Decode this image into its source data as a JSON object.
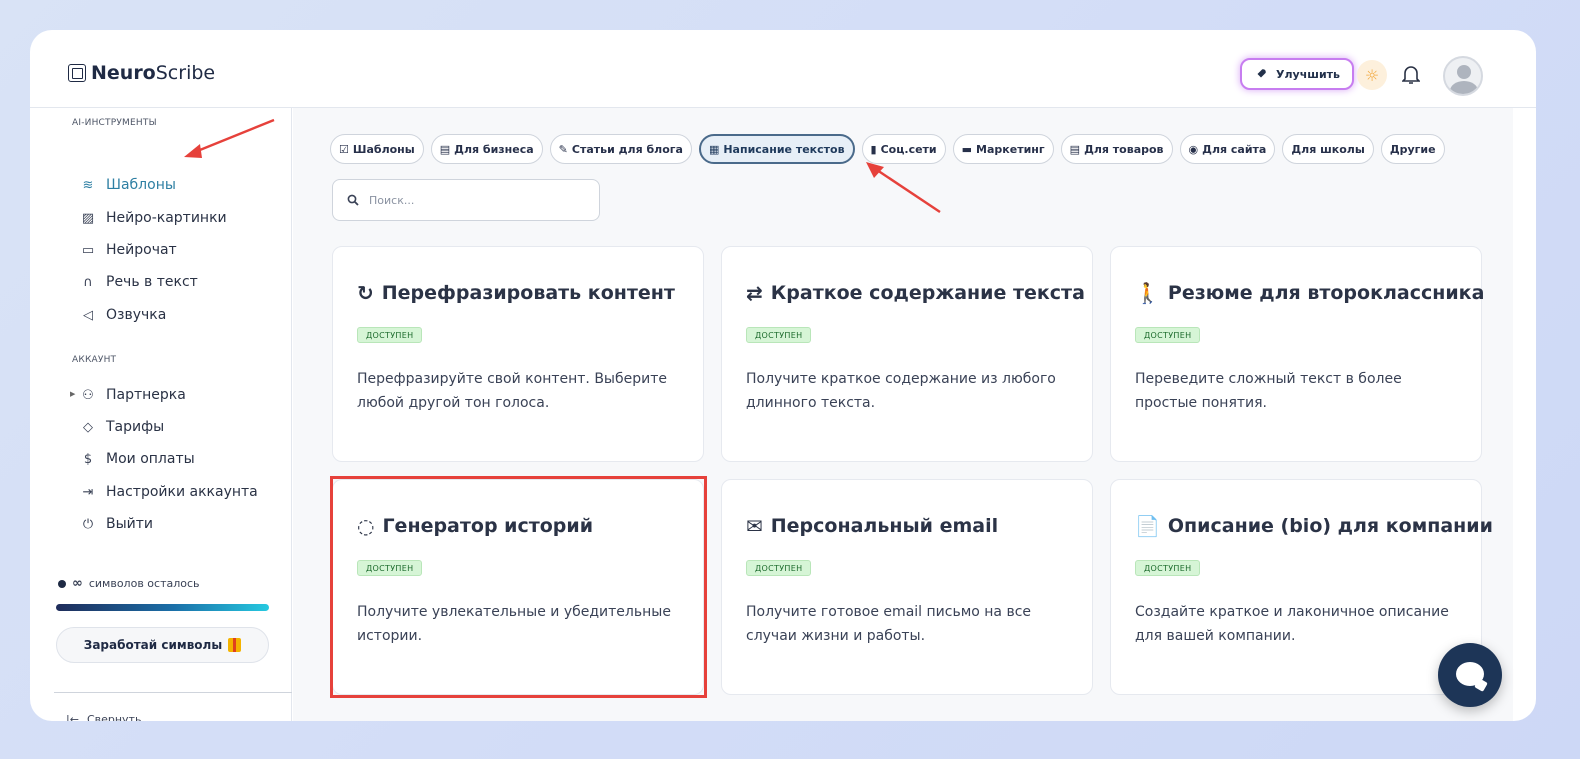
{
  "app": {
    "logo_bold": "Neuro",
    "logo_rest": "Scribe",
    "upgrade_label": "Улучшить"
  },
  "sidebar": {
    "section_tools": "AI-ИНСТРУМЕНТЫ",
    "tools": [
      {
        "label": "Шаблоны",
        "icon": "layers-icon",
        "active": true
      },
      {
        "label": "Нейро-картинки",
        "icon": "image-icon"
      },
      {
        "label": "Нейрочат",
        "icon": "chat-icon"
      },
      {
        "label": "Речь в текст",
        "icon": "headphones-icon"
      },
      {
        "label": "Озвучка",
        "icon": "speaker-icon"
      }
    ],
    "section_account": "АККАУНТ",
    "account": [
      {
        "label": "Партнерка",
        "icon": "users-icon"
      },
      {
        "label": "Тарифы",
        "icon": "tag-icon"
      },
      {
        "label": "Мои оплаты",
        "icon": "dollar-icon"
      },
      {
        "label": "Настройки аккаунта",
        "icon": "login-icon"
      },
      {
        "label": "Выйти",
        "icon": "power-icon"
      }
    ],
    "credits_value": "∞",
    "credits_text": "символов осталось",
    "credits_fill": 1.0,
    "earn_label": "Заработай символы",
    "collapse_label": "Свернуть"
  },
  "chips": [
    {
      "label": "Шаблоны",
      "icon": "☑"
    },
    {
      "label": "Для бизнеса",
      "icon": "▤"
    },
    {
      "label": "Статьи для блога",
      "icon": "✎"
    },
    {
      "label": "Написание текстов",
      "icon": "▦",
      "active": true
    },
    {
      "label": "Соц.сети",
      "icon": "▮"
    },
    {
      "label": "Маркетинг",
      "icon": "▬"
    },
    {
      "label": "Для товаров",
      "icon": "▤"
    },
    {
      "label": "Для сайта",
      "icon": "◉"
    },
    {
      "label": "Для школы",
      "icon": ""
    },
    {
      "label": "Другие",
      "icon": ""
    }
  ],
  "search": {
    "placeholder": "Поиск..."
  },
  "cards": [
    {
      "title": "Перефразировать контент",
      "icon": "↻",
      "badge": "ДОСТУПЕН",
      "desc": "Перефразируйте свой контент. Выберите любой другой тон голоса."
    },
    {
      "title": "Краткое содержание текста",
      "icon": "⇄",
      "badge": "ДОСТУПЕН",
      "desc": "Получите краткое содержание из любого длинного текста."
    },
    {
      "title": "Резюме для второклассника",
      "icon": "🚶",
      "badge": "ДОСТУПЕН",
      "desc": "Переведите сложный текст в более простые понятия."
    },
    {
      "title": "Генератор историй",
      "icon": "◌",
      "badge": "ДОСТУПЕН",
      "desc": "Получите увлекательные и убедительные истории."
    },
    {
      "title": "Персональный email",
      "icon": "✉",
      "badge": "ДОСТУПЕН",
      "desc": "Получите готовое email письмо на все случаи жизни и работы."
    },
    {
      "title": "Описание (bio) для компании",
      "icon": "📄",
      "badge": "ДОСТУПЕН",
      "desc": "Создайте краткое и лаконичное описание для вашей компании."
    }
  ],
  "colors": {
    "accent": "#2e7fa3",
    "annotation": "#e6413b",
    "badge_bg": "#d6f5d6"
  }
}
